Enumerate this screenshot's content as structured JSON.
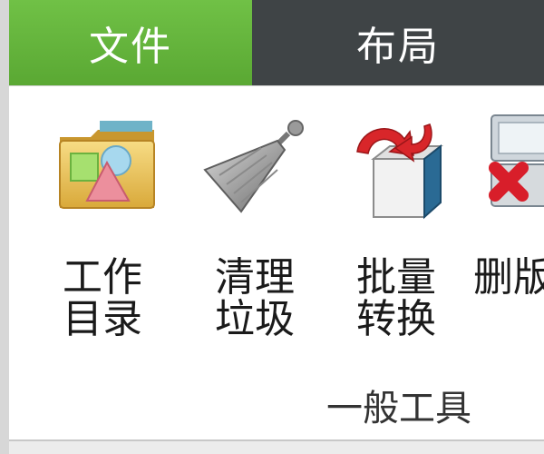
{
  "tabs": [
    {
      "label": "文件",
      "active": true
    },
    {
      "label": "布局",
      "active": false
    }
  ],
  "tools": [
    {
      "label": "工作\n目录",
      "icon": "folder-shapes-icon"
    },
    {
      "label": "清理\n垃圾",
      "icon": "broom-icon"
    },
    {
      "label": "批量\n转换",
      "icon": "batch-convert-icon"
    },
    {
      "label": "删版",
      "icon": "delete-version-icon"
    }
  ],
  "group_label": "一般工具",
  "colors": {
    "tab_active": "#5aa833",
    "tab_bar": "#3f4446",
    "ribbon_bg": "#ffffff"
  }
}
